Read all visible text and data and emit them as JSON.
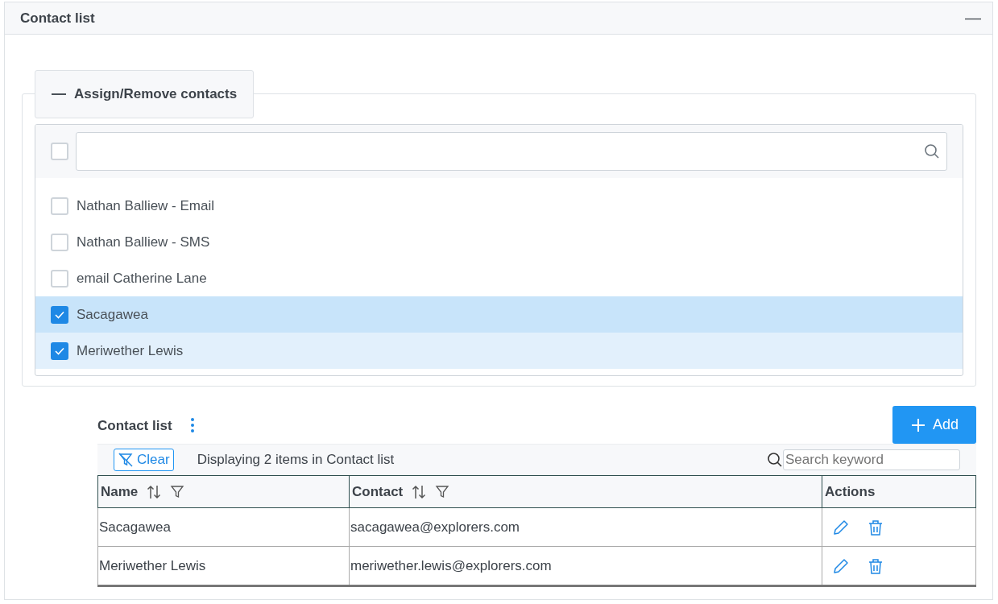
{
  "panel": {
    "title": "Contact list",
    "collapse_symbol": "—"
  },
  "assign": {
    "legend": "Assign/Remove contacts",
    "select_all_checked": false,
    "items": [
      {
        "label": "Nathan Balliew - Email",
        "checked": false,
        "focused": false
      },
      {
        "label": "Nathan Balliew - SMS",
        "checked": false,
        "focused": false
      },
      {
        "label": "email Catherine Lane",
        "checked": false,
        "focused": false
      },
      {
        "label": "Sacagawea",
        "checked": true,
        "focused": true
      },
      {
        "label": "Meriwether Lewis",
        "checked": true,
        "focused": false
      }
    ]
  },
  "grid": {
    "title": "Contact list",
    "add_button": "Add",
    "clear_button": "Clear",
    "status": "Displaying 2 items in Contact list",
    "search": {
      "placeholder": "Search keyword"
    },
    "columns": [
      {
        "label": "Name",
        "sortable": true,
        "filterable": true
      },
      {
        "label": "Contact",
        "sortable": true,
        "filterable": true
      },
      {
        "label": "Actions",
        "sortable": false,
        "filterable": false
      }
    ],
    "rows": [
      {
        "name": "Sacagawea",
        "contact": "sacagawea@explorers.com"
      },
      {
        "name": "Meriwether Lewis",
        "contact": "meriwether.lewis@explorers.com"
      }
    ]
  }
}
